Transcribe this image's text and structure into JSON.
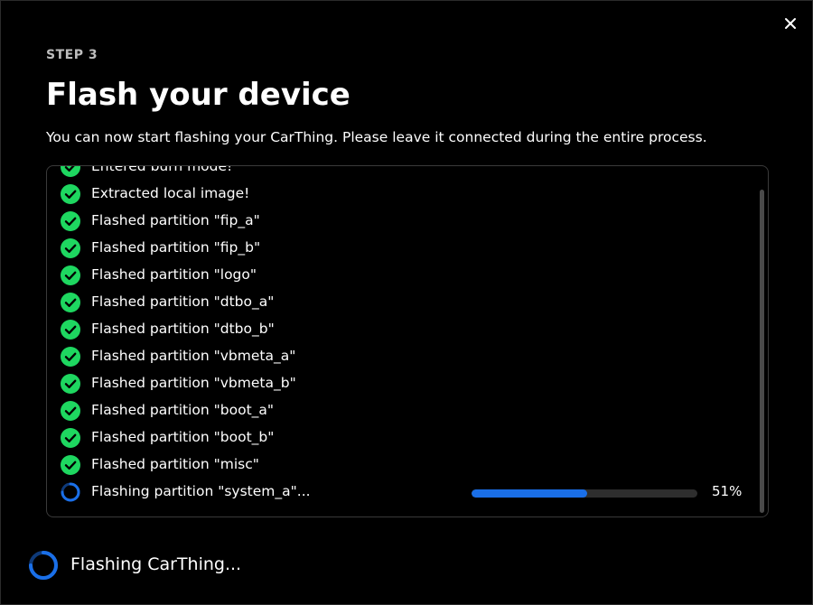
{
  "dialog": {
    "close_icon": "close-icon",
    "step_label": "STEP 3",
    "title": "Flash your device",
    "subtitle": "You can now start flashing your CarThing. Please leave it connected during the entire process."
  },
  "log": {
    "items": [
      {
        "text": "Entered burn mode!",
        "status": "done"
      },
      {
        "text": "Extracted local image!",
        "status": "done"
      },
      {
        "text": "Flashed partition \"fip_a\"",
        "status": "done"
      },
      {
        "text": "Flashed partition \"fip_b\"",
        "status": "done"
      },
      {
        "text": "Flashed partition \"logo\"",
        "status": "done"
      },
      {
        "text": "Flashed partition \"dtbo_a\"",
        "status": "done"
      },
      {
        "text": "Flashed partition \"dtbo_b\"",
        "status": "done"
      },
      {
        "text": "Flashed partition \"vbmeta_a\"",
        "status": "done"
      },
      {
        "text": "Flashed partition \"vbmeta_b\"",
        "status": "done"
      },
      {
        "text": "Flashed partition \"boot_a\"",
        "status": "done"
      },
      {
        "text": "Flashed partition \"boot_b\"",
        "status": "done"
      },
      {
        "text": "Flashed partition \"misc\"",
        "status": "done"
      }
    ],
    "current": {
      "text": "Flashing partition \"system_a\"...",
      "status": "in-progress",
      "progress_fraction": 0.51,
      "progress_label": "51%"
    }
  },
  "footer": {
    "status_text": "Flashing CarThing..."
  },
  "colors": {
    "success": "#1ed760",
    "progress": "#1a6fe8",
    "spinner": "#1a6fe8"
  }
}
